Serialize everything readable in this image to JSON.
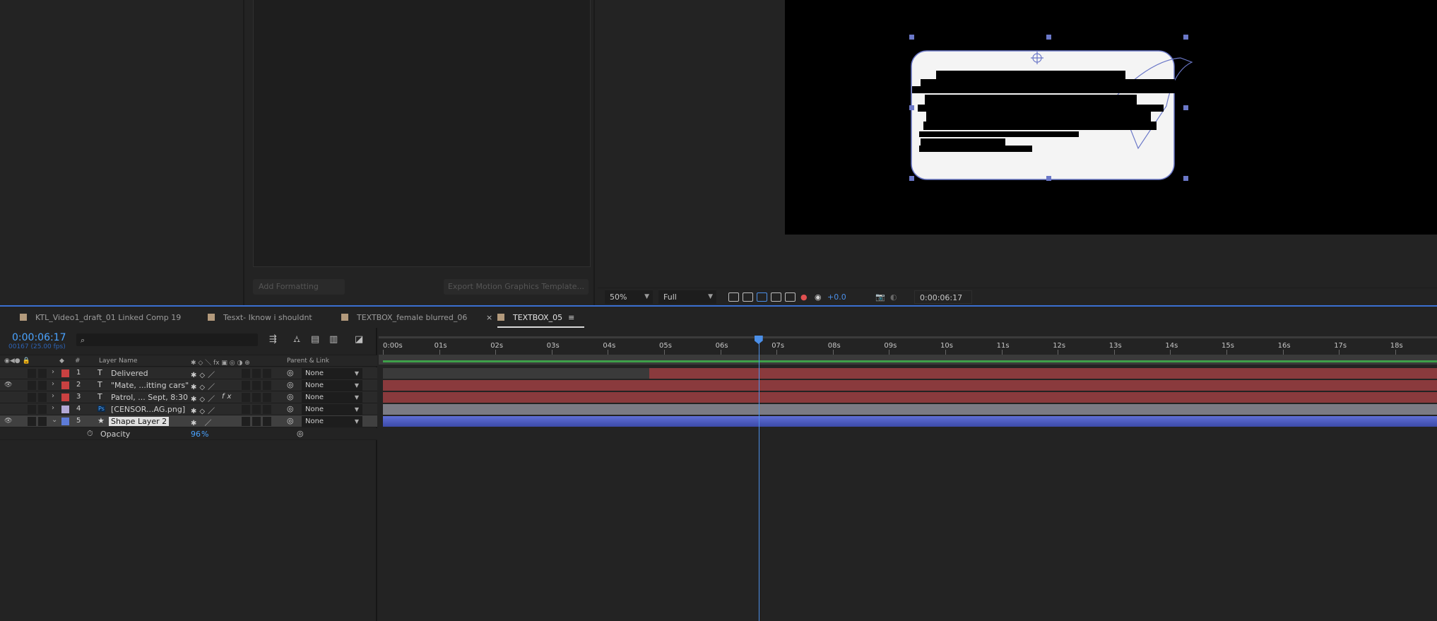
{
  "panels": {
    "egp": {
      "add_formatting": "Add Formatting",
      "export_template": "Export Motion Graphics Template..."
    }
  },
  "viewer": {
    "zoom": "50%",
    "resolution": "Full",
    "exposure": "+0.0",
    "timecode": "0:00:06:17"
  },
  "tabs": [
    {
      "label": "KTL_Video1_draft_01 Linked Comp 19",
      "color": "#b39a7c"
    },
    {
      "label": "Tesxt- Iknow i shouldnt",
      "color": "#b39a7c"
    },
    {
      "label": "TEXTBOX_female blurred_06",
      "color": "#b39a7c"
    },
    {
      "label": "TEXTBOX_05",
      "color": "#b39a7c",
      "active": true
    }
  ],
  "tabs_close": "×",
  "tabs_menu": "≡",
  "timeline": {
    "timecode": "0:00:06:17",
    "frames": "00167 (25.00 fps)",
    "search_placeholder": "",
    "headers": {
      "num": "#",
      "layer_name": "Layer Name",
      "parent_link": "Parent & Link"
    },
    "layers": [
      {
        "num": "1",
        "type": "T",
        "name": "Delivered",
        "label_color": "#c94141",
        "parent": "None",
        "eye": ""
      },
      {
        "num": "2",
        "type": "T",
        "name": "\"Mate, ...itting cars\"",
        "label_color": "#c94141",
        "parent": "None",
        "eye": "👁"
      },
      {
        "num": "3",
        "type": "T",
        "name": "Patrol, ... Sept, 8:30",
        "label_color": "#c94141",
        "parent": "None",
        "eye": "",
        "fx": "fx"
      },
      {
        "num": "4",
        "type": "Ps",
        "name": "[CENSOR...AG.png]",
        "label_color": "#b3a9d6",
        "parent": "None",
        "eye": ""
      },
      {
        "num": "5",
        "type": "★",
        "name": "Shape Layer 2",
        "label_color": "#5d7bd8",
        "parent": "None",
        "eye": "👁",
        "selected": true
      }
    ],
    "property": {
      "name": "Opacity",
      "value": "96",
      "unit": "%"
    },
    "ruler": [
      "0:00s",
      "01s",
      "02s",
      "03s",
      "04s",
      "05s",
      "06s",
      "07s",
      "08s",
      "09s",
      "10s",
      "11s",
      "12s",
      "13s",
      "14s",
      "15s",
      "16s",
      "17s",
      "18s"
    ],
    "current_time_sec": 6.68,
    "duration_sec": 18.7
  },
  "colors": {
    "accent": "#4b8fe8",
    "text_bar": "#8a3a3d",
    "image_bar": "#7b7b84",
    "shape_bar": "#4a58b8"
  }
}
